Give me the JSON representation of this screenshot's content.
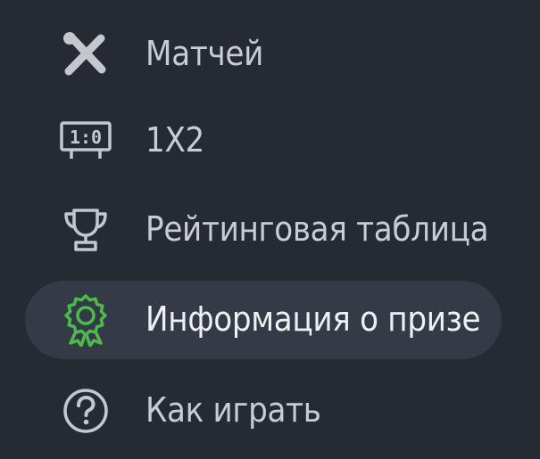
{
  "colors": {
    "background": "#262a33",
    "active_background": "#343a46",
    "text": "#c9ccd2",
    "active_text": "#eef0f3",
    "icon": "#c4c7cc",
    "accent": "#4dbb4a"
  },
  "menu": {
    "items": [
      {
        "label": "Матчей",
        "icon": "crossed-tools-icon",
        "active": false
      },
      {
        "label": "1X2",
        "icon": "scoreboard-icon",
        "scoreboard_text": "1:0",
        "active": false
      },
      {
        "label": "Рейтинговая таблица",
        "icon": "trophy-icon",
        "active": false
      },
      {
        "label": "Информация о призе",
        "icon": "award-ribbon-icon",
        "active": true
      },
      {
        "label": "Как играть",
        "icon": "help-circle-icon",
        "active": false
      }
    ]
  }
}
